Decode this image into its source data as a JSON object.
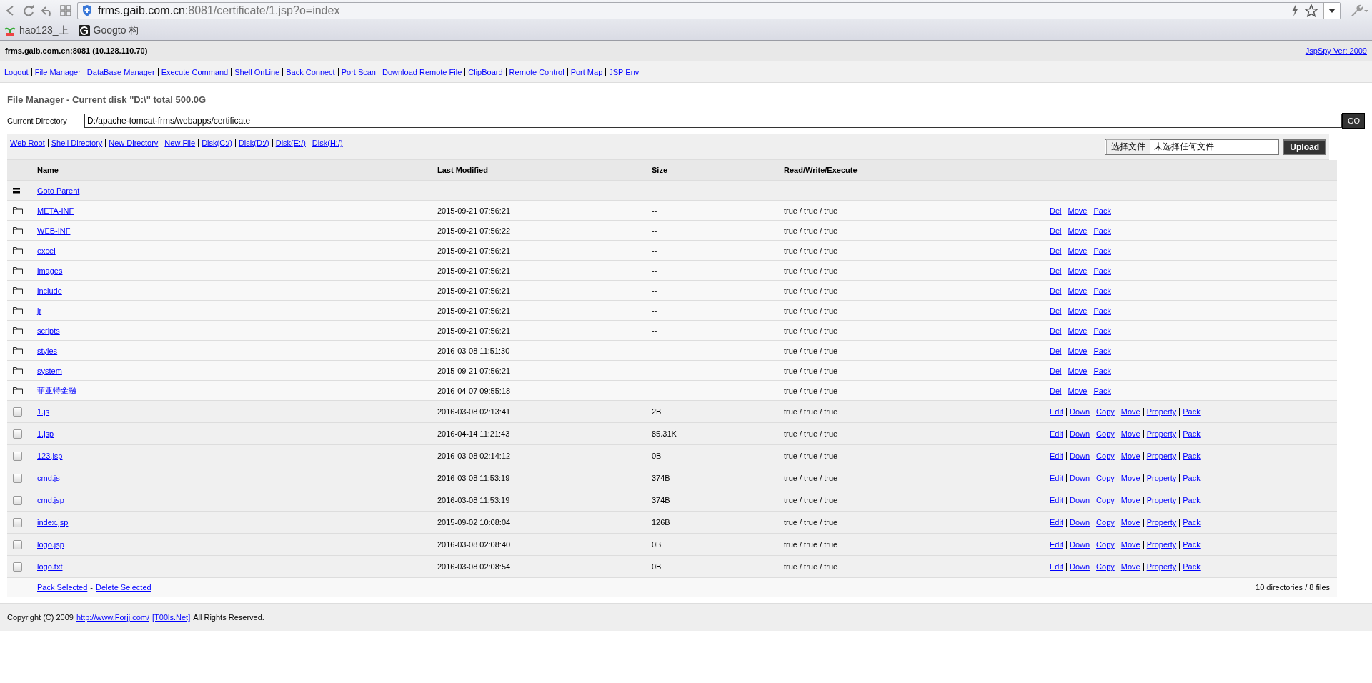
{
  "browser": {
    "url_host": "frms.gaib.com.cn",
    "url_rest": ":8081/certificate/1.jsp?o=index",
    "bookmarks": [
      {
        "label": "hao123_上",
        "kind": "hao"
      },
      {
        "label": "Googto 构",
        "kind": "g"
      }
    ]
  },
  "header": {
    "server": "frms.gaib.com.cn:8081 (10.128.110.70)",
    "version": "JspSpy Ver: 2009"
  },
  "nav": [
    "Logout",
    "File Manager",
    "DataBase Manager",
    "Execute Command",
    "Shell OnLine",
    "Back Connect",
    "Port Scan",
    "Download Remote File",
    "ClipBoard",
    "Remote Control",
    "Port Map",
    "JSP Env"
  ],
  "title": "File Manager - Current disk \"D:\\\" total 500.0G",
  "directory": {
    "label": "Current Directory",
    "value": "D:/apache-tomcat-frms/webapps/certificate",
    "button": "GO"
  },
  "shortcuts": [
    "Web Root",
    "Shell Directory",
    "New Directory",
    "New File",
    "Disk(C:/)",
    "Disk(D:/)",
    "Disk(E:/)",
    "Disk(H:/)"
  ],
  "upload": {
    "choose": "选择文件",
    "status": "未选择任何文件",
    "button": "Upload"
  },
  "table": {
    "columns": [
      "Name",
      "Last Modified",
      "Size",
      "Read/Write/Execute"
    ],
    "rows": [
      {
        "kind": "parent",
        "name": "Goto Parent"
      },
      {
        "kind": "dir",
        "name": "META-INF",
        "modified": "2015-09-21 07:56:21",
        "size": "--",
        "rwx": "true / true / true",
        "actions": [
          "Del",
          "Move",
          "Pack"
        ]
      },
      {
        "kind": "dir",
        "name": "WEB-INF",
        "modified": "2015-09-21 07:56:22",
        "size": "--",
        "rwx": "true / true / true",
        "actions": [
          "Del",
          "Move",
          "Pack"
        ]
      },
      {
        "kind": "dir",
        "name": "excel",
        "modified": "2015-09-21 07:56:21",
        "size": "--",
        "rwx": "true / true / true",
        "actions": [
          "Del",
          "Move",
          "Pack"
        ]
      },
      {
        "kind": "dir",
        "name": "images",
        "modified": "2015-09-21 07:56:21",
        "size": "--",
        "rwx": "true / true / true",
        "actions": [
          "Del",
          "Move",
          "Pack"
        ]
      },
      {
        "kind": "dir",
        "name": "include",
        "modified": "2015-09-21 07:56:21",
        "size": "--",
        "rwx": "true / true / true",
        "actions": [
          "Del",
          "Move",
          "Pack"
        ]
      },
      {
        "kind": "dir",
        "name": "jr",
        "modified": "2015-09-21 07:56:21",
        "size": "--",
        "rwx": "true / true / true",
        "actions": [
          "Del",
          "Move",
          "Pack"
        ]
      },
      {
        "kind": "dir",
        "name": "scripts",
        "modified": "2015-09-21 07:56:21",
        "size": "--",
        "rwx": "true / true / true",
        "actions": [
          "Del",
          "Move",
          "Pack"
        ]
      },
      {
        "kind": "dir",
        "name": "styles",
        "modified": "2016-03-08 11:51:30",
        "size": "--",
        "rwx": "true / true / true",
        "actions": [
          "Del",
          "Move",
          "Pack"
        ]
      },
      {
        "kind": "dir",
        "name": "system",
        "modified": "2015-09-21 07:56:21",
        "size": "--",
        "rwx": "true / true / true",
        "actions": [
          "Del",
          "Move",
          "Pack"
        ]
      },
      {
        "kind": "dir",
        "name": "菲亚特金融",
        "modified": "2016-04-07 09:55:18",
        "size": "--",
        "rwx": "true / true / true",
        "actions": [
          "Del",
          "Move",
          "Pack"
        ]
      },
      {
        "kind": "file",
        "checked": false,
        "name": "1.js",
        "modified": "2016-03-08 02:13:41",
        "size": "2B",
        "rwx": "true / true / true",
        "actions": [
          "Edit",
          "Down",
          "Copy",
          "Move",
          "Property",
          "Pack"
        ]
      },
      {
        "kind": "file",
        "checked": false,
        "name": "1.jsp",
        "modified": "2016-04-14 11:21:43",
        "size": "85.31K",
        "rwx": "true / true / true",
        "actions": [
          "Edit",
          "Down",
          "Copy",
          "Move",
          "Property",
          "Pack"
        ]
      },
      {
        "kind": "file",
        "checked": false,
        "name": "123.jsp",
        "modified": "2016-03-08 02:14:12",
        "size": "0B",
        "rwx": "true / true / true",
        "actions": [
          "Edit",
          "Down",
          "Copy",
          "Move",
          "Property",
          "Pack"
        ]
      },
      {
        "kind": "file",
        "checked": false,
        "name": "cmd.js",
        "modified": "2016-03-08 11:53:19",
        "size": "374B",
        "rwx": "true / true / true",
        "actions": [
          "Edit",
          "Down",
          "Copy",
          "Move",
          "Property",
          "Pack"
        ]
      },
      {
        "kind": "file",
        "checked": false,
        "name": "cmd.jsp",
        "modified": "2016-03-08 11:53:19",
        "size": "374B",
        "rwx": "true / true / true",
        "actions": [
          "Edit",
          "Down",
          "Copy",
          "Move",
          "Property",
          "Pack"
        ]
      },
      {
        "kind": "file",
        "checked": false,
        "name": "index.jsp",
        "modified": "2015-09-02 10:08:04",
        "size": "126B",
        "rwx": "true / true / true",
        "actions": [
          "Edit",
          "Down",
          "Copy",
          "Move",
          "Property",
          "Pack"
        ]
      },
      {
        "kind": "file",
        "checked": false,
        "name": "logo.jsp",
        "modified": "2016-03-08 02:08:40",
        "size": "0B",
        "rwx": "true / true / true",
        "actions": [
          "Edit",
          "Down",
          "Copy",
          "Move",
          "Property",
          "Pack"
        ]
      },
      {
        "kind": "file",
        "checked": false,
        "name": "logo.txt",
        "modified": "2016-03-08 02:08:54",
        "size": "0B",
        "rwx": "true / true / true",
        "actions": [
          "Edit",
          "Down",
          "Copy",
          "Move",
          "Property",
          "Pack"
        ]
      }
    ],
    "footer": {
      "pack": "Pack Selected",
      "dash": "-",
      "delete": "Delete Selected",
      "summary": "10 directories / 8 files"
    }
  },
  "copyright": {
    "text": "Copyright (C) 2009",
    "link1": "http://www.Forjj.com/",
    "link2": "[T00ls.Net]",
    "tail": "All Rights Reserved."
  }
}
